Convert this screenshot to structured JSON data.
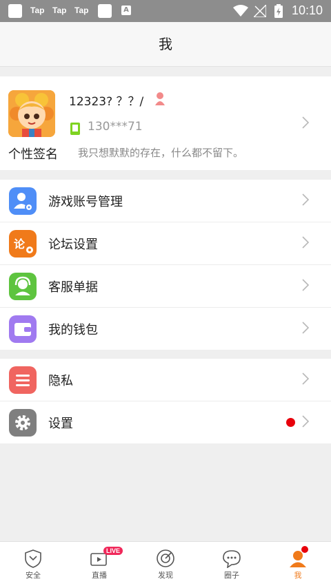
{
  "status_bar": {
    "tap_labels": [
      "Tap",
      "Tap",
      "Tap"
    ],
    "time": "10:10"
  },
  "header": {
    "title": "我"
  },
  "profile": {
    "username": "12323? ？？/",
    "phone": "130***71",
    "signature_label": "个性签名",
    "signature": "我只想默默的存在，什么都不留下。"
  },
  "menu_group_1": [
    {
      "label": "游戏账号管理",
      "icon": "account-manage-icon",
      "color": "#4f8ef7"
    },
    {
      "label": "论坛设置",
      "icon": "forum-settings-icon",
      "color": "#f07a1a"
    },
    {
      "label": "客服单据",
      "icon": "customer-service-icon",
      "color": "#5ec43f"
    },
    {
      "label": "我的钱包",
      "icon": "wallet-icon",
      "color": "#a07af0"
    }
  ],
  "menu_group_2": [
    {
      "label": "隐私",
      "icon": "privacy-icon",
      "color": "#f06560"
    },
    {
      "label": "设置",
      "icon": "gear-icon",
      "color": "#7f7f7f",
      "has_notification_dot": true
    }
  ],
  "tabbar": {
    "tabs": [
      {
        "label": "安全",
        "icon": "shield-icon"
      },
      {
        "label": "直播",
        "icon": "live-tv-icon",
        "badge": "LIVE"
      },
      {
        "label": "发现",
        "icon": "compass-icon"
      },
      {
        "label": "圈子",
        "icon": "chat-bubble-icon"
      },
      {
        "label": "我",
        "icon": "user-icon",
        "active": true
      }
    ]
  },
  "colors": {
    "accent": "#f07a1a",
    "notification": "#e8000b",
    "live_badge": "#f0285a"
  }
}
